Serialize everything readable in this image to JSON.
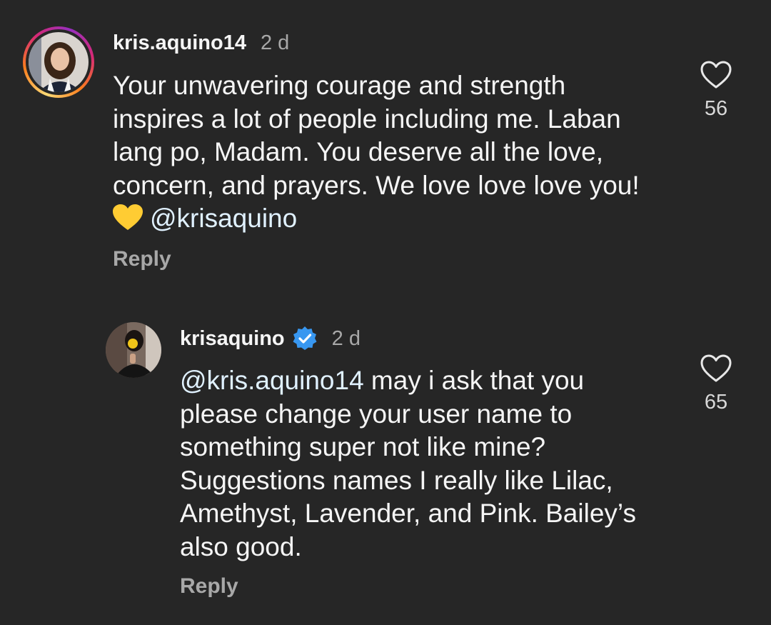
{
  "comments": [
    {
      "username": "kris.aquino14",
      "time": "2 d",
      "lines": [
        "Your unwavering courage and strength",
        "inspires a lot of people including me. Laban",
        "lang po, Madam. You deserve all the love,",
        "concern, and prayers. We love love love you!"
      ],
      "last_line_mention": "@krisaquino",
      "emoji": "yellow-heart",
      "reply_label": "Reply",
      "likes": "56"
    },
    {
      "username": "krisaquino",
      "verified": true,
      "time": "2 d",
      "mention": "@kris.aquino14",
      "lines": [
        " may i ask that you",
        "please change your user name to",
        "something super not like mine?",
        "Suggestions names I really like Lilac,",
        "Amethyst, Lavender, and Pink. Bailey’s",
        "also good."
      ],
      "reply_label": "Reply",
      "likes": "65"
    }
  ],
  "icons": {
    "like": "heart-outline-icon",
    "verified": "verified-badge-icon"
  },
  "colors": {
    "background": "#262626",
    "verified_blue": "#3897f0",
    "heart_yellow": "#ffcc33"
  }
}
